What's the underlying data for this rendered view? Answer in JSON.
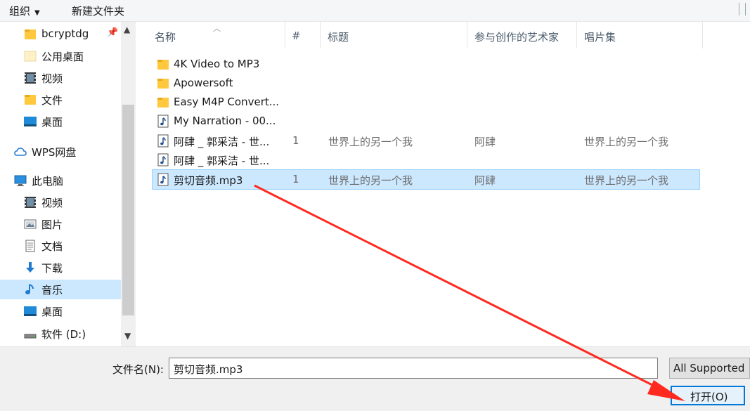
{
  "toolbar": {
    "organize": "组织",
    "new_folder": "新建文件夹"
  },
  "nav": {
    "items": [
      {
        "label": "bcryptdg",
        "icon": "folder-icon",
        "pinned": true
      },
      {
        "label": "公用桌面",
        "icon": "folder-light-icon"
      },
      {
        "label": "视频",
        "icon": "video-icon"
      },
      {
        "label": "文件",
        "icon": "folder-icon"
      },
      {
        "label": "桌面",
        "icon": "desktop-icon"
      },
      {
        "label": "WPS网盘",
        "icon": "cloud-icon"
      },
      {
        "label": "此电脑",
        "icon": "computer-icon"
      },
      {
        "label": "视频",
        "icon": "video-icon"
      },
      {
        "label": "图片",
        "icon": "picture-icon"
      },
      {
        "label": "文档",
        "icon": "document-icon"
      },
      {
        "label": "下载",
        "icon": "download-icon"
      },
      {
        "label": "音乐",
        "icon": "music-icon",
        "selected": true
      },
      {
        "label": "桌面",
        "icon": "desktop-icon"
      },
      {
        "label": "软件 (D:)",
        "icon": "drive-icon"
      }
    ]
  },
  "columns": {
    "name": "名称",
    "number": "#",
    "title": "标题",
    "artist": "参与创作的艺术家",
    "album": "唱片集"
  },
  "files": [
    {
      "name": "4K Video to MP3",
      "type": "folder",
      "num": "",
      "title": "",
      "artist": "",
      "album": ""
    },
    {
      "name": "Apowersoft",
      "type": "folder",
      "num": "",
      "title": "",
      "artist": "",
      "album": ""
    },
    {
      "name": "Easy M4P Convert...",
      "type": "folder",
      "num": "",
      "title": "",
      "artist": "",
      "album": ""
    },
    {
      "name": "My Narration - 00...",
      "type": "audio",
      "num": "",
      "title": "",
      "artist": "",
      "album": ""
    },
    {
      "name": "阿肆 _ 郭采洁 - 世...",
      "type": "audio",
      "num": "1",
      "title": "世界上的另一个我",
      "artist": "阿肆",
      "album": "世界上的另一个我"
    },
    {
      "name": "阿肆 _ 郭采洁 - 世...",
      "type": "audio",
      "num": "",
      "title": "",
      "artist": "",
      "album": ""
    },
    {
      "name": "剪切音频.mp3",
      "type": "audio",
      "num": "1",
      "title": "世界上的另一个我",
      "artist": "阿肆",
      "album": "世界上的另一个我",
      "selected": true
    }
  ],
  "bottom": {
    "filename_label": "文件名(N):",
    "filename_value": "剪切音频.mp3",
    "filter": "All Supported",
    "open_button": "打开(O)"
  },
  "colors": {
    "selection": "#cce8ff",
    "accent": "#0078d7",
    "annotation_arrow": "#ff2a1f"
  }
}
